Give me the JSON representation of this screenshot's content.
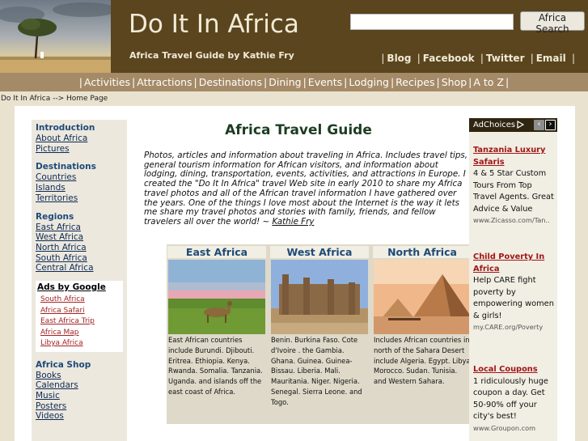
{
  "header": {
    "site_title": "Do It In Africa",
    "tagline": "Africa Travel Guide by Kathie Fry",
    "search_button": "Africa Search",
    "search_value": "",
    "top_links": [
      "Blog",
      "Facebook",
      "Twitter",
      "Email"
    ]
  },
  "nav": {
    "items": [
      "Activities",
      "Attractions",
      "Destinations",
      "Dining",
      "Events",
      "Lodging",
      "Recipes",
      "Shop",
      "A to Z"
    ]
  },
  "breadcrumb": "Do It In Africa --> Home Page",
  "sidebar": {
    "introduction": {
      "heading": "Introduction",
      "links": [
        "About Africa",
        "Pictures"
      ]
    },
    "destinations": {
      "heading": "Destinations",
      "links": [
        "Countries",
        "Islands",
        "Territories"
      ]
    },
    "regions": {
      "heading": "Regions",
      "links": [
        "East Africa",
        "West Africa",
        "North Africa",
        "South Africa",
        "Central Africa"
      ]
    },
    "ads": {
      "title": "Ads by Google",
      "links": [
        "South Africa",
        "Africa Safari",
        "East Africa Trip",
        "Africa Map",
        "Libya Africa"
      ]
    },
    "shop": {
      "heading": "Africa Shop",
      "links": [
        "Books",
        "Calendars",
        "Music",
        "Posters",
        "Videos"
      ]
    }
  },
  "main": {
    "title": "Africa Travel Guide",
    "intro": "Photos, articles and information about traveling in Africa. Includes travel tips, general tourism information for African visitors, and information about lodging, dining, transportation, events, activities, and attractions in Europe. I created the \"Do It In Africa\" travel Web site in early 2010 to share my Africa travel photos and all of the African travel information I have gathered over the years. One of the things I love most about the Internet is the way it lets me share my travel photos and stories with family, friends, and fellow travelers all over the world! ~ ",
    "intro_author": "Kathie Fry",
    "regions": [
      {
        "title": "East Africa",
        "text": "East African countries include Burundi. Djibouti. Eritrea. Ethiopia. Kenya. Rwanda. Somalia. Tanzania. Uganda. and islands off the east coast of Africa."
      },
      {
        "title": "West Africa",
        "text": "Benin. Burkina Faso. Cote d'Ivoire . the Gambia. Ghana. Guinea. Guinea-Bissau. Liberia. Mali. Mauritania. Niger. Nigeria. Senegal. Sierra Leone. and Togo."
      },
      {
        "title": "North Africa",
        "text": "Includes African countries in north of the Sahara Desert include Algeria. Egypt. Libya Morocco. Sudan. Tunisia. and Western Sahara."
      }
    ]
  },
  "adcolumn": {
    "adchoices": "AdChoices",
    "ads": [
      {
        "title": "Tanzania Luxury Safaris",
        "body": "4 & 5 Star Custom Tours From Top Travel Agents. Great Advice & Value",
        "url": "www.Zicasso.com/Tan.."
      },
      {
        "title": "Child Poverty In Africa",
        "body": "Help CARE fight poverty by empowering women & girls!",
        "url": "my.CARE.org/Poverty"
      },
      {
        "title": "Local Coupons",
        "body": "1 ridiculously huge coupon a day. Get 50-90% off your city's best!",
        "url": "www.Groupon.com"
      }
    ]
  }
}
